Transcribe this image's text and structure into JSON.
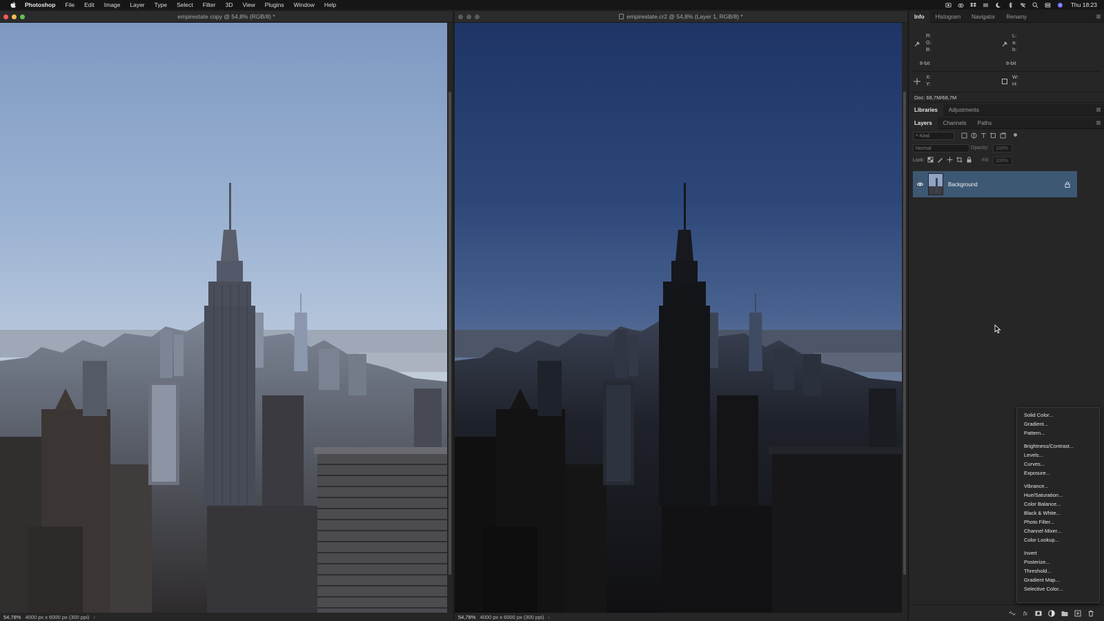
{
  "menubar": {
    "app_name": "Photoshop",
    "items": [
      "File",
      "Edit",
      "Image",
      "Layer",
      "Type",
      "Select",
      "Filter",
      "3D",
      "View",
      "Plugins",
      "Window",
      "Help"
    ],
    "clock": "Thu 18:23"
  },
  "left_window": {
    "title": "empirestate copy @ 54,8% (RGB/8) *",
    "zoom": "54,78%",
    "doc_info": "4000 px x 6000 px (300 ppi)",
    "chevron": "›"
  },
  "right_window": {
    "title": "empirestate.cr2 @ 54,8% (Layer 1, RGB/8) *",
    "zoom": "54,78%",
    "doc_info": "4000 px x 6000 px (300 ppi)",
    "chevron": "›"
  },
  "info_panel": {
    "tabs": [
      "Info",
      "Histogram",
      "Navigator",
      "Renamy"
    ],
    "rgb_labels": [
      "R:",
      "G:",
      "B:"
    ],
    "lab_labels": [
      "L:",
      "a:",
      "b:"
    ],
    "bit_left": "8-bit",
    "bit_right": "8-bit",
    "xy_labels": [
      "X:",
      "Y:"
    ],
    "wh_labels": [
      "W:",
      "H:"
    ],
    "doc_size": "Doc: 68,7M/68,7M"
  },
  "lib_panel": {
    "tabs": [
      "Libraries",
      "Adjustments"
    ]
  },
  "layers_panel": {
    "tabs": [
      "Layers",
      "Channels",
      "Paths"
    ],
    "kind_filter": "Kind",
    "blend_mode": "Normal",
    "opacity_label": "Opacity:",
    "opacity_value": "100%",
    "lock_label": "Lock:",
    "fill_label": "Fill:",
    "fill_value": "100%",
    "layers": [
      {
        "name": "Background",
        "visible": true,
        "locked": true
      }
    ]
  },
  "adjustment_menu": {
    "groups": [
      [
        "Solid Color...",
        "Gradient...",
        "Pattern..."
      ],
      [
        "Brightness/Contrast...",
        "Levels...",
        "Curves...",
        "Exposure..."
      ],
      [
        "Vibrance...",
        "Hue/Saturation...",
        "Color Balance...",
        "Black & White...",
        "Photo Filter...",
        "Channel Mixer...",
        "Color Lookup..."
      ],
      [
        "Invert",
        "Posterize...",
        "Threshold...",
        "Gradient Map...",
        "Selective Color..."
      ]
    ]
  },
  "colors": {
    "selected_layer": "#3d5873",
    "panel_bg": "#262626",
    "close_light": "#ed5e57",
    "min_light": "#f5bd4f",
    "max_light": "#5fc454"
  }
}
